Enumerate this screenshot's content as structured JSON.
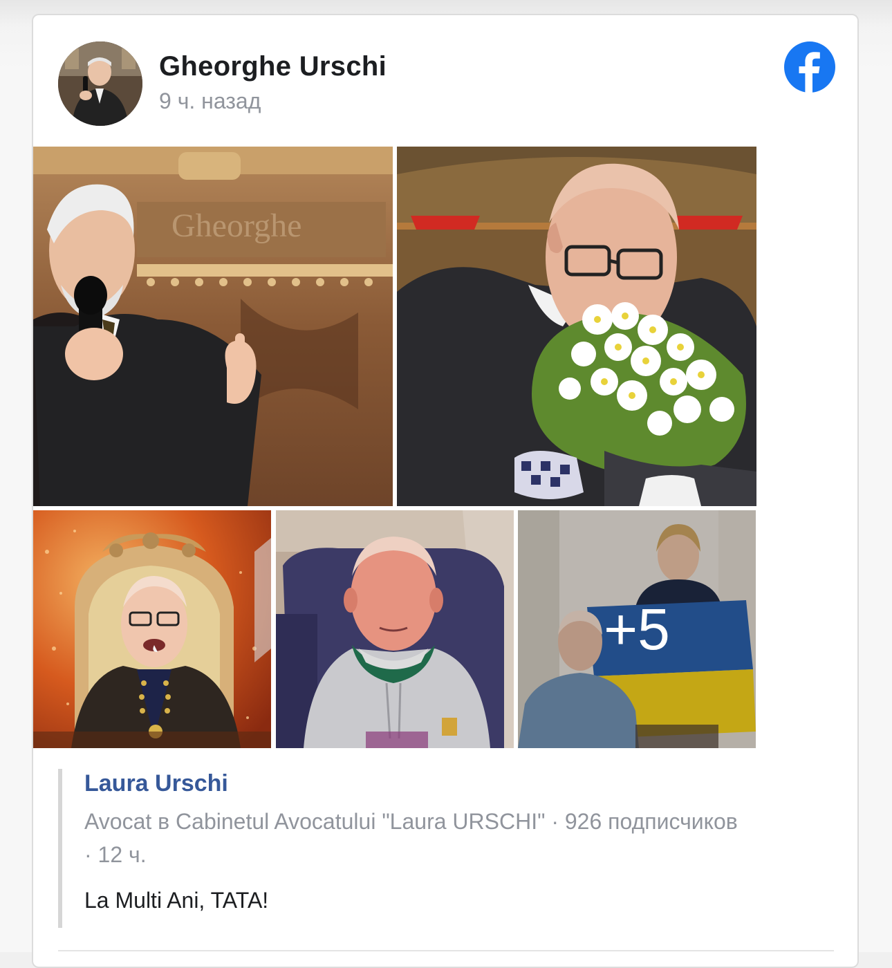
{
  "post": {
    "author_name": "Gheorghe Urschi",
    "time": "9 ч. назад",
    "platform_icon": "facebook-logo-icon",
    "brand_color": "#1877f2",
    "photos": [
      {
        "name": "photo-singer-microphone",
        "description_icon": "photo"
      },
      {
        "name": "photo-man-with-flowers",
        "description_icon": "photo"
      },
      {
        "name": "photo-man-on-throne",
        "description_icon": "photo"
      },
      {
        "name": "photo-man-in-armchair",
        "description_icon": "photo"
      },
      {
        "name": "photo-man-with-flag",
        "description_icon": "photo"
      }
    ],
    "more_photos_label": "+5"
  },
  "shared": {
    "author_name": "Laura Urschi",
    "meta_line_1": "Avocat в Cabinetul Avocatului \"Laura URSCHI\" · 926 подписчиков",
    "meta_line_2": "· 12 ч.",
    "text": "La Multi Ani, TATA!",
    "link_color": "#365899"
  }
}
